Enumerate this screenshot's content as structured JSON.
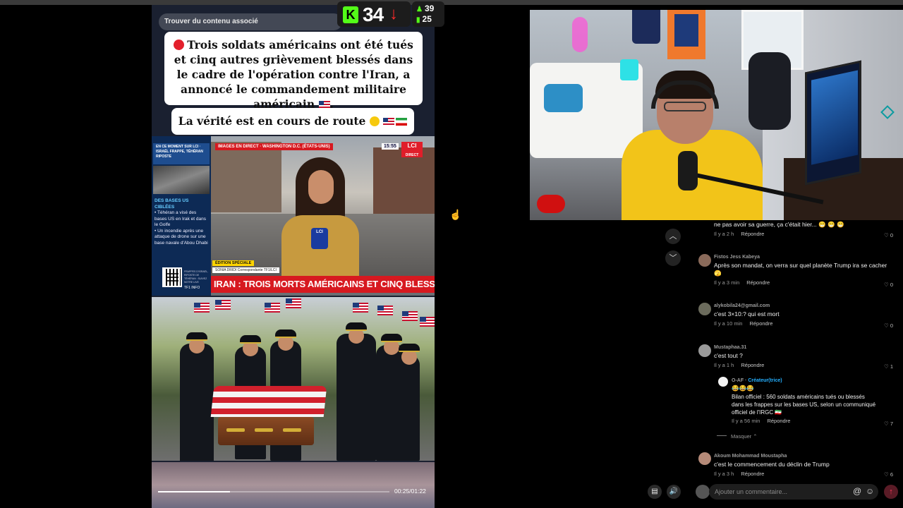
{
  "video": {
    "related_label": "Trouver du contenu associé",
    "headline": "Trois soldats américains ont été tués et cinq autres grièvement blessés dans le cadre de l'opération contre l'Iran, a annoncé le commandement militaire américain",
    "truth_line": "La vérité est en cours de route",
    "news": {
      "sidebar_top": "EN CE MOMENT SUR LCI · ISRAËL FRAPPE, TÉHÉRAN RIPOSTE",
      "sidebar_heading": "DES BASES US CIBLÉES",
      "sidebar_bullet1": "• Téhéran a visé des bases US en Irak et dans le Golfe",
      "sidebar_bullet2": "• Un incendie après une attaque de drone sur une base navale d'Abou Dhabi",
      "qr_text": "FRAPPES D'ISRAËL, RIPOSTE DE TÉHÉRAN : SUIVEZ NOTRE LIVE",
      "live_tag": "IMAGES EN DIRECT · WASHINGTON D.C. (ÉTATS-UNIS)",
      "clock": "15:55",
      "channel": "LCI",
      "channel_sub": "DIRECT",
      "mic_label": "LCI",
      "edition": "ÉDITION SPÉCIALE",
      "reporter": "SONIA DRIDI  Correspondante TF1/LCI",
      "title": "IRAN : TROIS MORTS AMÉRICAINS ET CINQ BLESSÉS",
      "network": "TF1 INFO"
    },
    "progress": 0.31,
    "time": "00:25/01:22"
  },
  "overlay": {
    "counter": "34",
    "stat_a": "39",
    "stat_b": "25"
  },
  "comments": [
    {
      "author": "",
      "text": "ne pas avoir sa guerre, ça c'était hier... 😁 😁 😁",
      "time": "Il y a 2 h",
      "reply": "Répondre",
      "likes": "0"
    },
    {
      "author": "Fistos Jess Kabeya",
      "text": "Après son mandat, on verra sur quel planète Trump ira se cacher 🫣",
      "time": "Il y a 3 min",
      "reply": "Répondre",
      "likes": "0"
    },
    {
      "author": "alykobila24@gmail.com",
      "text": "c'est 3×10:? qui est mort",
      "time": "Il y a 10 min",
      "reply": "Répondre",
      "likes": "0"
    },
    {
      "author": "Mustaphaa.31",
      "text": "c'est tout ?",
      "time": "Il y a 1 h",
      "reply": "Répondre",
      "likes": "1"
    },
    {
      "author": "O-AF ·",
      "badge": "Créateur(trice)",
      "emoji_line": "😂😂😂",
      "text": "Bilan officiel : 560 soldats américains tués ou blessés dans les frappes sur les bases US, selon un communiqué officiel de l'IRGC 🇮🇷",
      "time": "Il y a 56 min",
      "reply": "Répondre",
      "likes": "7"
    },
    {
      "author": "Akoum Mohammad Moustapha",
      "text": "c'est le commencement du déclin de Trump",
      "time": "Il y a 3 h",
      "reply": "Répondre",
      "likes": "6"
    }
  ],
  "mask_label": "Masquer",
  "comment_placeholder": "Ajouter un commentaire...",
  "icons": [
    "chevron-up-icon",
    "chevron-down-icon",
    "heart-icon",
    "volume-icon",
    "mention-icon",
    "emoji-icon",
    "send-icon"
  ]
}
